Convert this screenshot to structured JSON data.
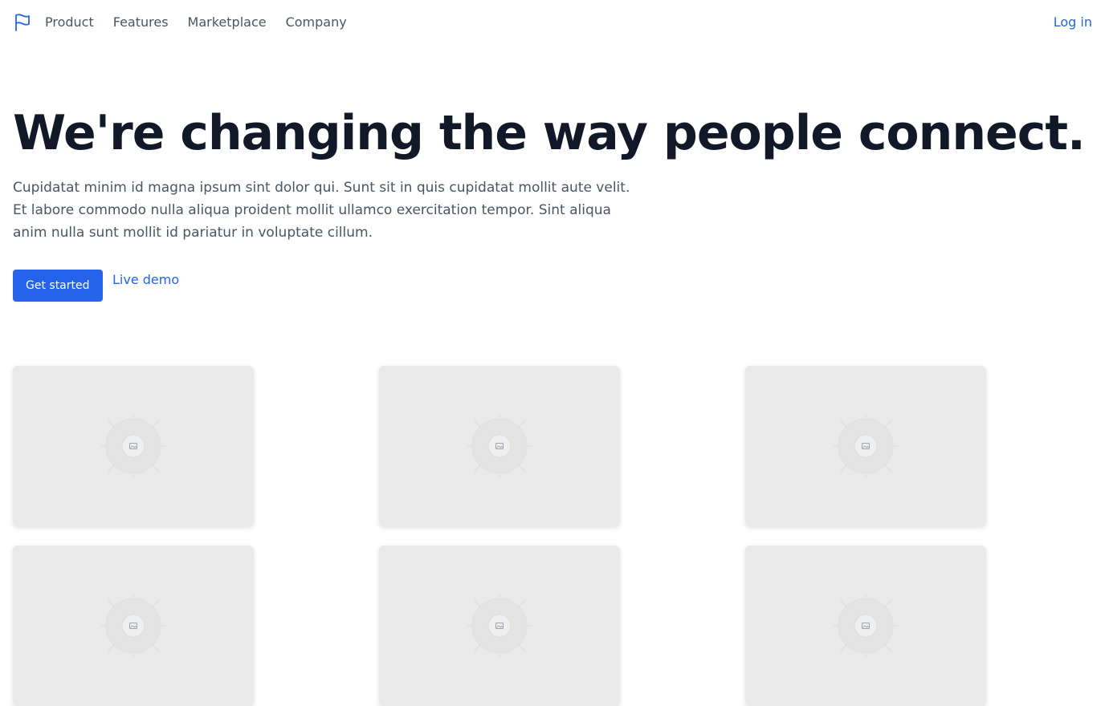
{
  "nav": {
    "logo_icon": "flag-icon",
    "links": [
      "Product",
      "Features",
      "Marketplace",
      "Company"
    ],
    "login": "Log in"
  },
  "hero": {
    "title": "We're changing the way people connect.",
    "description": [
      "Cupidatat minim id magna ipsum sint dolor qui. Sunt sit in quis cupidatat mollit aute velit.",
      "Et labore commodo nulla aliqua proident mollit ullamco exercitation tempor. Sint aliqua",
      "anim nulla sunt mollit id pariatur in voluptate cillum."
    ],
    "primary_button": "Get started",
    "secondary_link": "Live demo"
  },
  "gallery": {
    "placeholder_icon": "image-placeholder-icon",
    "count": 6
  },
  "colors": {
    "accent": "#2563eb",
    "heading": "#111827",
    "body_text": "#4b5563",
    "card_bg": "#eaeaea"
  }
}
